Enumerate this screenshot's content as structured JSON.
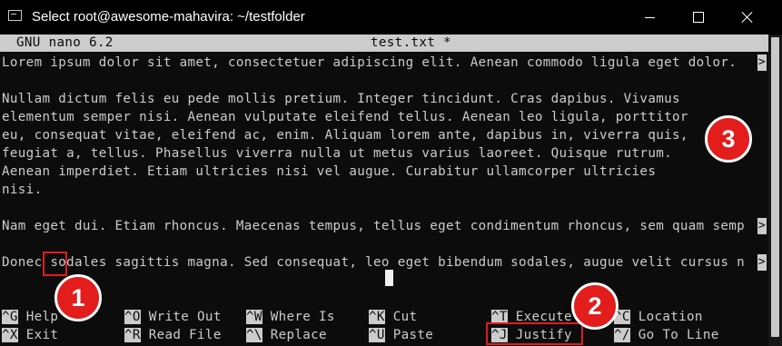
{
  "window": {
    "title": "Select root@awesome-mahavira: ~/testfolder"
  },
  "nano": {
    "version": "GNU nano 6.2",
    "filename": "test.txt *"
  },
  "editor": {
    "lines": [
      "Lorem ipsum dolor sit amet, consectetuer adipiscing elit. Aenean commodo ligula eget dolor.",
      "",
      "Nullam dictum felis eu pede mollis pretium. Integer tincidunt. Cras dapibus. Vivamus",
      "elementum semper nisi. Aenean vulputate eleifend tellus. Aenean leo ligula, porttitor",
      "eu, consequat vitae, eleifend ac, enim. Aliquam lorem ante, dapibus in, viverra quis,",
      "feugiat a, tellus. Phasellus viverra nulla ut metus varius laoreet. Quisque rutrum.",
      "Aenean imperdiet. Etiam ultricies nisi vel augue. Curabitur ullamcorper ultricies",
      "nisi.",
      "",
      "Nam eget dui. Etiam rhoncus. Maecenas tempus, tellus eget condimentum rhoncus, sem quam semp",
      "",
      "Donec sodales sagittis magna. Sed consequat, leo eget bibendum sodales, augue velit cursus n"
    ],
    "overflow_marker": ">"
  },
  "shortcuts": {
    "row1": [
      {
        "key": "^G",
        "label": " Help"
      },
      {
        "key": "^O",
        "label": " Write Out"
      },
      {
        "key": "^W",
        "label": " Where Is"
      },
      {
        "key": "^K",
        "label": " Cut"
      },
      {
        "key": "^T",
        "label": " Execute"
      },
      {
        "key": "^C",
        "label": " Location"
      }
    ],
    "row2": [
      {
        "key": "^X",
        "label": " Exit"
      },
      {
        "key": "^R",
        "label": " Read File"
      },
      {
        "key": "^\\",
        "label": " Replace"
      },
      {
        "key": "^U",
        "label": " Paste"
      },
      {
        "key": "^J",
        "label": " Justify"
      },
      {
        "key": "^/",
        "label": " Go To Line"
      }
    ]
  },
  "annotations": {
    "badges": [
      "1",
      "2",
      "3"
    ],
    "color": "#e31c1c"
  }
}
